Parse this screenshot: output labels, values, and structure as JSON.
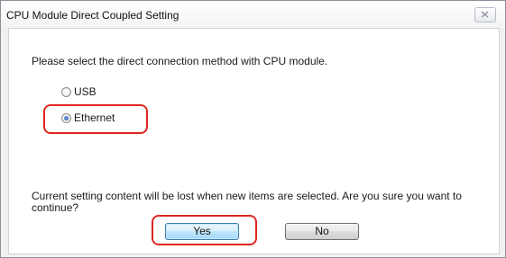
{
  "window": {
    "title": "CPU Module Direct Coupled Setting",
    "close_icon": "close-icon"
  },
  "prompt": "Please select the direct connection method with CPU module.",
  "options": [
    {
      "label": "USB",
      "selected": false
    },
    {
      "label": "Ethernet",
      "selected": true
    }
  ],
  "warning": "Current setting content will be lost when new items are selected. Are you sure you want to continue?",
  "buttons": {
    "yes": "Yes",
    "no": "No"
  },
  "colors": {
    "highlight": "#e0261f",
    "default_button_border": "#3c7fb1"
  }
}
